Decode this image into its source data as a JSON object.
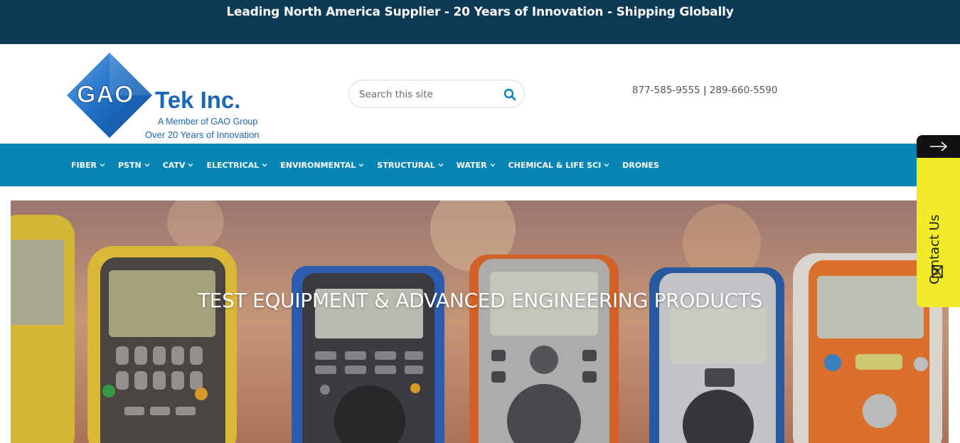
{
  "topbar": {
    "text": "Leading North America Supplier - 20 Years of Innovation - Shipping Globally"
  },
  "logo": {
    "letters": "GAO",
    "name": "Tek Inc.",
    "member": "A Member of GAO Group",
    "years": "Over 20 Years of Innovation",
    "brand_color": "#1b66b7"
  },
  "search": {
    "placeholder": "Search this site",
    "value": "",
    "icon": "search-icon"
  },
  "phones": {
    "primary": "877-585-9555",
    "separator": "|",
    "secondary": "289-660-5590"
  },
  "nav": {
    "background": "#0485b4",
    "items": [
      {
        "label": "FIBER",
        "has_dropdown": true
      },
      {
        "label": "PSTN",
        "has_dropdown": true
      },
      {
        "label": "CATV",
        "has_dropdown": true
      },
      {
        "label": "ELECTRICAL",
        "has_dropdown": true
      },
      {
        "label": "ENVIRONMENTAL",
        "has_dropdown": true
      },
      {
        "label": "STRUCTURAL",
        "has_dropdown": true
      },
      {
        "label": "WATER",
        "has_dropdown": true
      },
      {
        "label": "CHEMICAL & LIFE SCI",
        "has_dropdown": true
      },
      {
        "label": "DRONES",
        "has_dropdown": false
      }
    ]
  },
  "hero": {
    "title": "TEST EQUIPMENT & ADVANCED ENGINEERING PRODUCTS"
  },
  "contact_tab": {
    "label": "Contact Us",
    "arrow_icon": "arrow-right-icon",
    "mail_icon": "mail-icon",
    "color": "#f1ea29"
  }
}
